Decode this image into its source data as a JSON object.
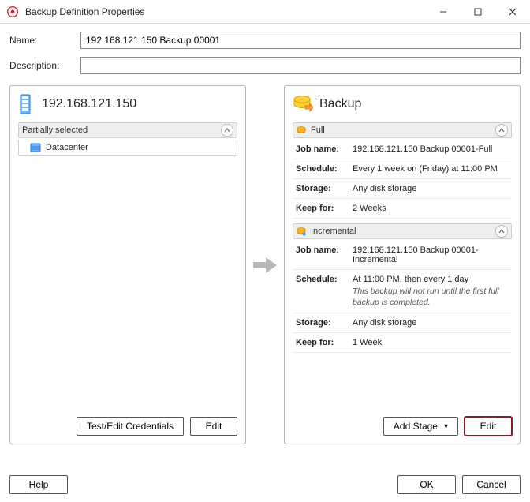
{
  "window": {
    "title": "Backup Definition Properties"
  },
  "form": {
    "name_label": "Name:",
    "name_value": "192.168.121.150 Backup 00001",
    "desc_label": "Description:",
    "desc_value": ""
  },
  "left_panel": {
    "title": "192.168.121.150",
    "section_label": "Partially selected",
    "tree": {
      "item0": "Datacenter"
    },
    "buttons": {
      "test_edit": "Test/Edit Credentials",
      "edit": "Edit"
    }
  },
  "right_panel": {
    "title": "Backup",
    "stages": {
      "full": {
        "label": "Full",
        "job_name_k": "Job name:",
        "job_name_v": "192.168.121.150 Backup 00001-Full",
        "schedule_k": "Schedule:",
        "schedule_v": "Every 1 week on (Friday) at 11:00 PM",
        "storage_k": "Storage:",
        "storage_v": "Any disk storage",
        "keep_k": "Keep for:",
        "keep_v": "2 Weeks"
      },
      "incremental": {
        "label": "Incremental",
        "job_name_k": "Job name:",
        "job_name_v": "192.168.121.150 Backup 00001-Incremental",
        "schedule_k": "Schedule:",
        "schedule_v": "At 11:00 PM, then every 1 day",
        "schedule_note": "This backup will not run until the first full backup is completed.",
        "storage_k": "Storage:",
        "storage_v": "Any disk storage",
        "keep_k": "Keep for:",
        "keep_v": "1 Week"
      }
    },
    "buttons": {
      "add_stage": "Add Stage",
      "edit": "Edit"
    }
  },
  "bottom": {
    "help": "Help",
    "ok": "OK",
    "cancel": "Cancel"
  }
}
